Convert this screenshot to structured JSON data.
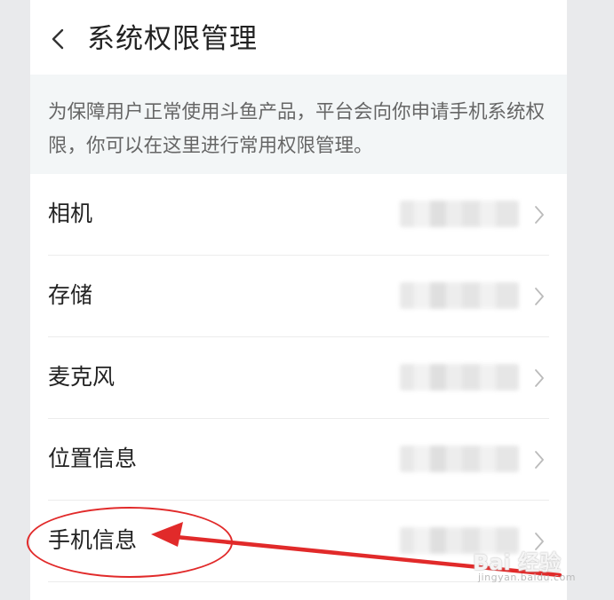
{
  "header": {
    "back_icon": "chevron-left-icon",
    "title": "系统权限管理"
  },
  "notice": {
    "text": "为保障用户正常使用斗鱼产品，平台会向你申请手机系统权限，你可以在这里进行常用权限管理。"
  },
  "permissions": [
    {
      "label": "相机"
    },
    {
      "label": "存储"
    },
    {
      "label": "麦克风"
    },
    {
      "label": "位置信息"
    },
    {
      "label": "手机信息"
    }
  ],
  "annotation": {
    "highlighted_item": "手机信息",
    "color": "#e12a2a"
  },
  "watermark": {
    "main": "Bai 经验",
    "sub": "jingyan.baidu.com"
  },
  "colors": {
    "title": "#222222",
    "notice_bg": "#f3f6f7",
    "notice_text": "#666666",
    "divider": "#ececec",
    "chevron": "#bbbbbb"
  }
}
